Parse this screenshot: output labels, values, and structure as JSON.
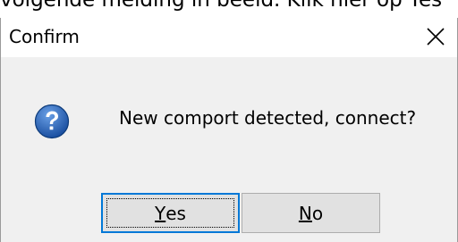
{
  "document": {
    "partial_text": "volgende melding in beeld. Klik hier op Yes"
  },
  "dialog": {
    "title": "Confirm",
    "close_icon": "close-icon",
    "message": "New comport detected, connect?",
    "icon": "question-icon",
    "buttons": {
      "yes": {
        "mnemonic": "Y",
        "rest": "es"
      },
      "no": {
        "mnemonic": "N",
        "rest": "o"
      }
    },
    "colors": {
      "accent": "#0078d7",
      "icon_blue": "#1a5fb4",
      "face": "#f0f0f0"
    }
  }
}
